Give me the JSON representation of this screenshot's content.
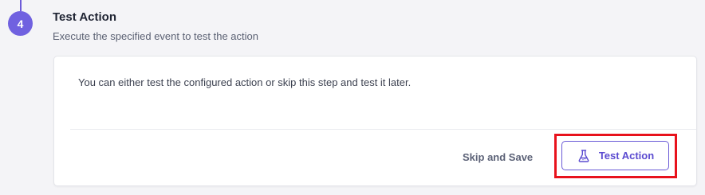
{
  "step": {
    "number": "4",
    "title": "Test Action",
    "subtitle": "Execute the specified event to test the action"
  },
  "card": {
    "message": "You can either test the configured action or skip this step and test it later."
  },
  "actions": {
    "skip_label": "Skip and Save",
    "test_label": "Test Action",
    "test_icon": "flask-icon"
  },
  "colors": {
    "accent": "#7061e0",
    "highlight": "#e8121c"
  }
}
